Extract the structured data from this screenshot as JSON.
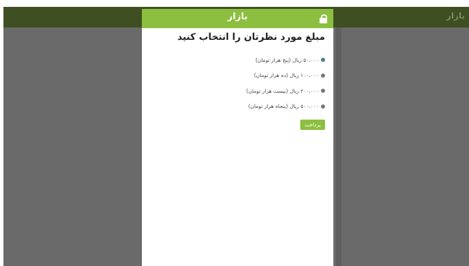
{
  "background": {
    "brand": "بازار"
  },
  "modal": {
    "brand": "بازار",
    "title": "مبلغ مورد نظرتان را انتخاب کنید",
    "options": [
      {
        "label": "۵۰،۰۰۰ ریال (پنج هزار تومان)",
        "selected": true
      },
      {
        "label": "۱۰۰،۰۰۰ ریال (ده هزار تومان)",
        "selected": false
      },
      {
        "label": "۲۰۰،۰۰۰ ریال (بیست هزار تومان)",
        "selected": false
      },
      {
        "label": "۵۰۰،۰۰۰ ریال (پنجاه هزار تومان)",
        "selected": false
      }
    ],
    "pay_label": "پرداخت"
  },
  "colors": {
    "accent": "#8cbf3f",
    "selected_radio": "#4a7e8f",
    "overlay": "#6f6f6f"
  }
}
